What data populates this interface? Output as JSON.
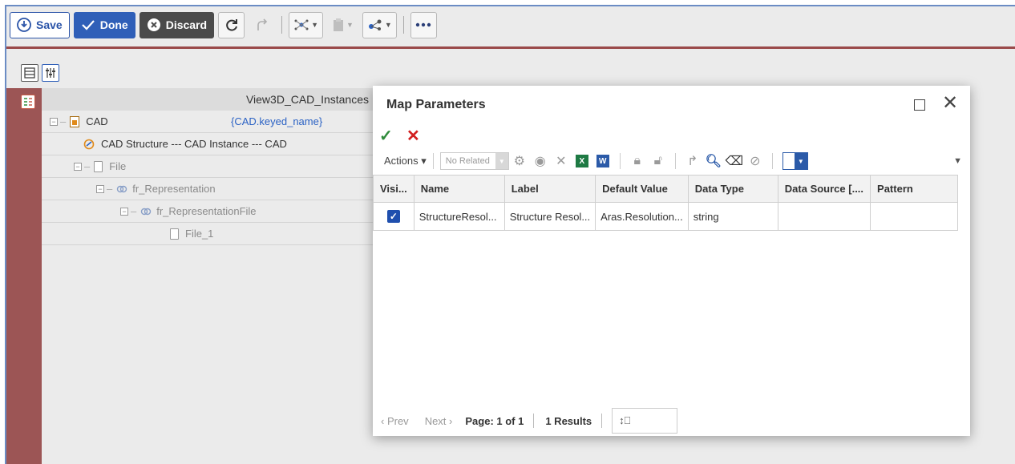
{
  "toolbar": {
    "save_label": "Save",
    "done_label": "Done",
    "discard_label": "Discard"
  },
  "tree": {
    "header": "View3D_CAD_Instances",
    "rows": [
      {
        "label": "CAD",
        "binding": "{CAD.keyed_name}"
      },
      {
        "label": "CAD Structure --- CAD Instance --- CAD"
      },
      {
        "label": "File"
      },
      {
        "label": "fr_Representation"
      },
      {
        "label": "fr_RepresentationFile"
      },
      {
        "label": "File_1"
      }
    ]
  },
  "dialog": {
    "title": "Map Parameters",
    "actions_label": "Actions",
    "related_select": "No Related",
    "columns": [
      "Visi...",
      "Name",
      "Label",
      "Default Value",
      "Data Type",
      "Data Source [....",
      "Pattern"
    ],
    "rows": [
      {
        "visible": true,
        "name": "StructureResol...",
        "label": "Structure Resol...",
        "default_value": "Aras.Resolution...",
        "data_type": "string",
        "data_source": "",
        "pattern": ""
      }
    ],
    "pager": {
      "prev": "Prev",
      "next": "Next",
      "page": "Page: 1 of 1",
      "results": "1 Results"
    }
  }
}
